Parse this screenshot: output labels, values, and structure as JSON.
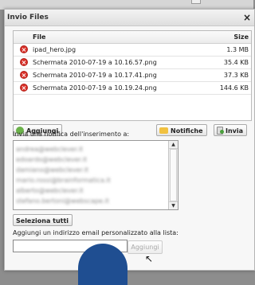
{
  "dialog": {
    "title": "Invio Files",
    "close": "×"
  },
  "files": {
    "header": {
      "file": "File",
      "size": "Size"
    },
    "rows": [
      {
        "name": "ipad_hero.jpg",
        "size": "1.3 MB"
      },
      {
        "name": "Schermata 2010-07-19 a 10.16.57.png",
        "size": "35.4 KB"
      },
      {
        "name": "Schermata 2010-07-19 a 10.17.41.png",
        "size": "37.3 KB"
      },
      {
        "name": "Schermata 2010-07-19 a 10.19.24.png",
        "size": "144.6 KB"
      }
    ],
    "remove_icon": "remove-icon"
  },
  "buttons": {
    "add": "Aggiungi",
    "notify": "Notifiche",
    "send": "Invia",
    "select_all": "Seleziona tutti",
    "add_email": "Aggiungi"
  },
  "labels": {
    "notify_prompt": "Invia una notifica dell'inserimento a:",
    "add_email_prompt": "Aggiungi un indirizzo email personalizzato alla lista:"
  },
  "emails": [
    "andrea@webclever.it",
    "edoardo@webclever.it",
    "damiano@webclever.it",
    "mario.rossi@brainformatica.it",
    "alberto@webclever.it",
    "stefano.bertoni@webscape.it"
  ],
  "email_input": {
    "value": "",
    "placeholder": ""
  },
  "colors": {
    "remove": "#d9322a",
    "overlay": "#1f4e91"
  }
}
